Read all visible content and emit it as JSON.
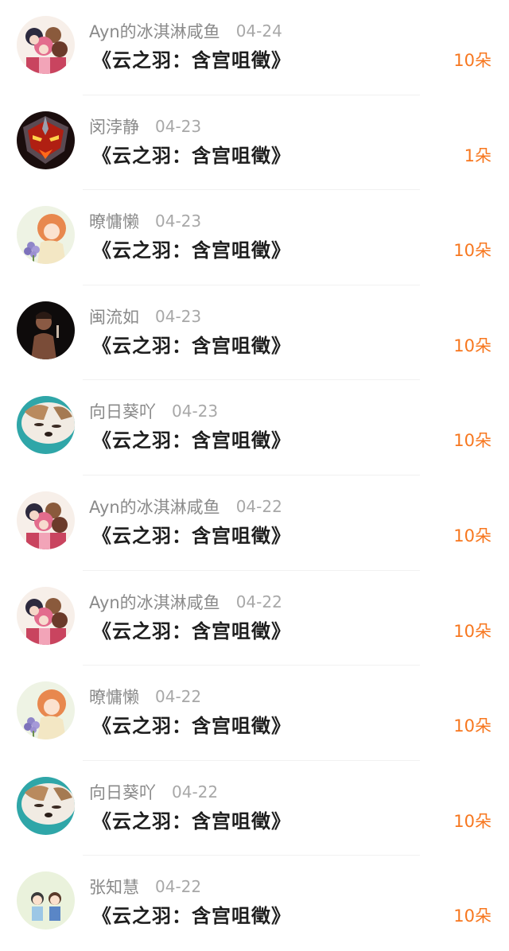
{
  "gift_records": [
    {
      "user": "Ayn的冰淇淋咸鱼",
      "date": "04-24",
      "title": "《云之羽：含宫咀徵》",
      "amount": "10朵",
      "avatar_icon": "avatar-anime-group-icon"
    },
    {
      "user": "闵浡静",
      "date": "04-23",
      "title": "《云之羽：含宫咀徵》",
      "amount": "1朵",
      "avatar_icon": "avatar-warrior-helmet-icon"
    },
    {
      "user": "暸慵懒",
      "date": "04-23",
      "title": "《云之羽：含宫咀徵》",
      "amount": "10朵",
      "avatar_icon": "avatar-anime-girl-flowers-icon"
    },
    {
      "user": "闽流如",
      "date": "04-23",
      "title": "《云之羽：含宫咀徵》",
      "amount": "10朵",
      "avatar_icon": "avatar-man-dark-icon"
    },
    {
      "user": "向日葵吖",
      "date": "04-23",
      "title": "《云之羽：含宫咀徵》",
      "amount": "10朵",
      "avatar_icon": "avatar-sleeping-dog-icon"
    },
    {
      "user": "Ayn的冰淇淋咸鱼",
      "date": "04-22",
      "title": "《云之羽：含宫咀徵》",
      "amount": "10朵",
      "avatar_icon": "avatar-anime-group-icon"
    },
    {
      "user": "Ayn的冰淇淋咸鱼",
      "date": "04-22",
      "title": "《云之羽：含宫咀徵》",
      "amount": "10朵",
      "avatar_icon": "avatar-anime-group-icon"
    },
    {
      "user": "暸慵懒",
      "date": "04-22",
      "title": "《云之羽：含宫咀徵》",
      "amount": "10朵",
      "avatar_icon": "avatar-anime-girl-flowers-icon"
    },
    {
      "user": "向日葵吖",
      "date": "04-22",
      "title": "《云之羽：含宫咀徵》",
      "amount": "10朵",
      "avatar_icon": "avatar-sleeping-dog-icon"
    },
    {
      "user": "张知慧",
      "date": "04-22",
      "title": "《云之羽：含宫咀徵》",
      "amount": "10朵",
      "avatar_icon": "avatar-couple-cartoon-icon"
    }
  ],
  "colors": {
    "amount": "#f7771f",
    "username": "#8a8a8a",
    "date": "#a8a8a8",
    "title": "#1e1e1e",
    "divider": "#f1f1f1"
  }
}
